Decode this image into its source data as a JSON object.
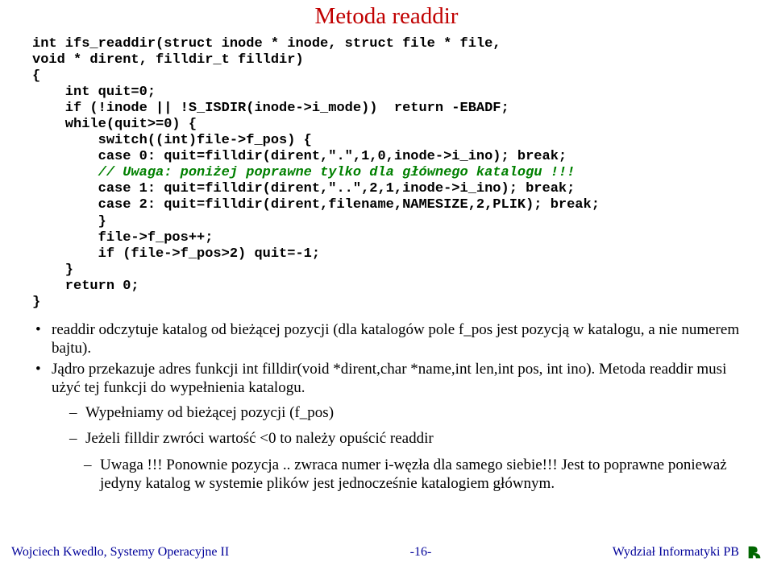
{
  "title": "Metoda readdir",
  "code": {
    "l1": "int ifs_readdir(struct inode * inode, struct file * file,",
    "l2": "void * dirent, filldir_t filldir)",
    "l3": "{",
    "l4": "    int quit=0;",
    "l5": "    if (!inode || !S_ISDIR(inode->i_mode))  return -EBADF;",
    "l6": "    while(quit>=0) {",
    "l7": "        switch((int)file->f_pos) {",
    "l8": "        case 0: quit=filldir(dirent,\".\",1,0,inode->i_ino); break;",
    "l9a": "        ",
    "l9b": "// Uwaga: poniżej poprawne tylko dla głównego katalogu !!!",
    "l10": "        case 1: quit=filldir(dirent,\"..\",2,1,inode->i_ino); break;",
    "l11": "        case 2: quit=filldir(dirent,filename,NAMESIZE,2,PLIK); break;",
    "l12": "        }",
    "l13": "        file->f_pos++;",
    "l14": "        if (file->f_pos>2) quit=-1;",
    "l15": "    }",
    "l16": "    return 0;",
    "l17": "}"
  },
  "bullets": [
    "readdir odczytuje katalog od bieżącej pozycji (dla katalogów pole f_pos jest pozycją w katalogu, a nie numerem bajtu).",
    "Jądro przekazuje adres funkcji int filldir(void *dirent,char *name,int len,int pos, int ino). Metoda readdir musi użyć tej funkcji do wypełnienia katalogu."
  ],
  "sub": [
    "Wypełniamy od bieżącej pozycji (f_pos)",
    "Jeżeli filldir zwróci wartość <0 to należy opuścić readdir"
  ],
  "sub2": "Uwaga !!! Ponownie pozycja .. zwraca numer i-węzła dla samego siebie!!! Jest to poprawne ponieważ jedyny katalog w systemie plików jest jednocześnie katalogiem głównym.",
  "footer": {
    "left": "Wojciech Kwedlo, Systemy Operacyjne II",
    "center": "-16-",
    "right": "Wydział Informatyki     PB"
  }
}
